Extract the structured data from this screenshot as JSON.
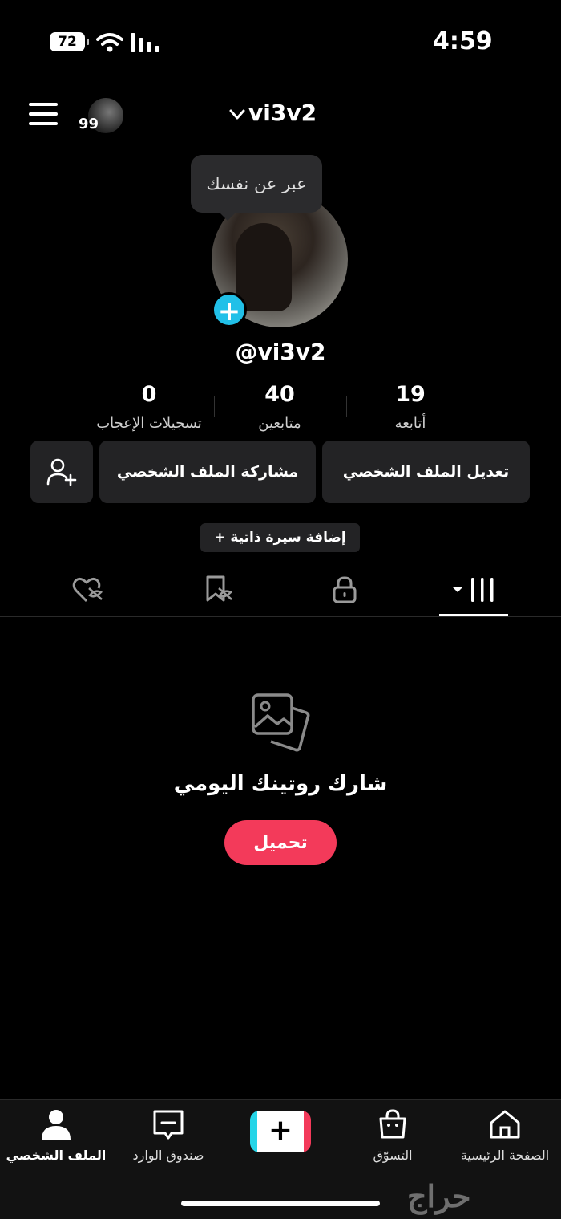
{
  "status_bar": {
    "time": "4:59",
    "battery": "72"
  },
  "header": {
    "username": "vi3v2",
    "notification_count": "99"
  },
  "tooltip": {
    "text": "عبر عن نفسك"
  },
  "profile": {
    "handle": "@vi3v2"
  },
  "stats": [
    {
      "value": "19",
      "label": "أتابعه"
    },
    {
      "value": "40",
      "label": "متابعين"
    },
    {
      "value": "0",
      "label": "تسجيلات الإعجاب"
    }
  ],
  "buttons": {
    "edit_profile": "تعديل الملف الشخصي",
    "share_profile": "مشاركة الملف الشخصي",
    "add_bio": "+ إضافة سيرة ذاتية"
  },
  "tabs": [
    "videos-grid-icon",
    "lock-icon",
    "bookmark-icon",
    "liked-icon"
  ],
  "empty_state": {
    "title": "شارك روتينك اليومي",
    "upload_label": "تحميل"
  },
  "bottom_nav": {
    "home": "الصفحة الرئيسية",
    "shop": "التسوّق",
    "inbox": "صندوق الوارد",
    "profile": "الملف الشخصي"
  },
  "watermark": "حراج",
  "colors": {
    "accent_pink": "#f33a5a",
    "accent_cyan": "#21c0e8",
    "button_bg": "#232325"
  }
}
